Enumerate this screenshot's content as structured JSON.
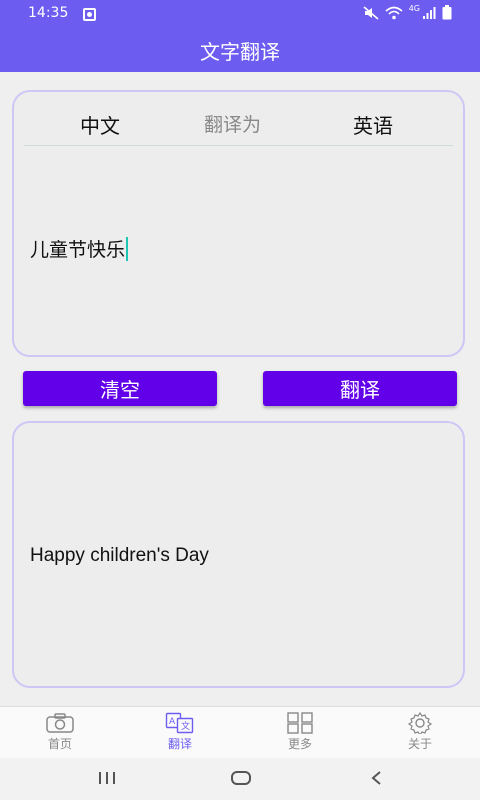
{
  "status_bar": {
    "time": "14:35",
    "network": "4G"
  },
  "title_bar": {
    "title": "文字翻译"
  },
  "input_card": {
    "source_lang": "中文",
    "translate_to": "翻译为",
    "target_lang": "英语",
    "text": "儿童节快乐"
  },
  "buttons": {
    "clear": "清空",
    "translate": "翻译"
  },
  "output_card": {
    "text": "Happy children's Day"
  },
  "bottom_nav": {
    "items": [
      {
        "label": "首页",
        "icon": "camera-icon"
      },
      {
        "label": "翻译",
        "icon": "translate-icon",
        "active": true
      },
      {
        "label": "更多",
        "icon": "grid-icon"
      },
      {
        "label": "关于",
        "icon": "gear-icon"
      }
    ]
  },
  "colors": {
    "accent": "#6c5cf0",
    "button": "#6200ea",
    "caret": "#1fc6b6"
  }
}
